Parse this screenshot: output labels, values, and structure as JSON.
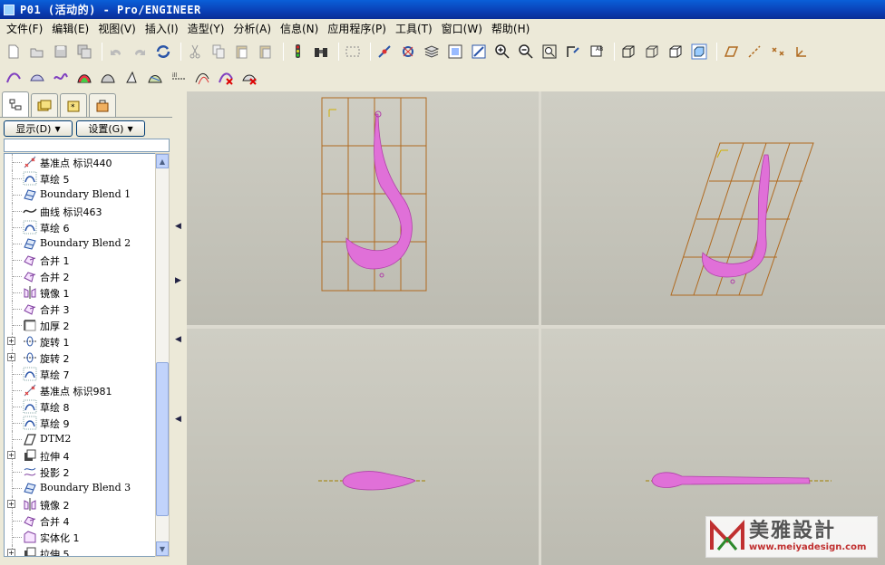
{
  "window": {
    "title": "P01 (活动的) - Pro/ENGINEER"
  },
  "menu": [
    "文件(F)",
    "编辑(E)",
    "视图(V)",
    "插入(I)",
    "造型(Y)",
    "分析(A)",
    "信息(N)",
    "应用程序(P)",
    "工具(T)",
    "窗口(W)",
    "帮助(H)"
  ],
  "toolbar1": [
    "new-file-icon",
    "open-file-icon",
    "save-icon",
    "save-copy-icon",
    "undo-icon",
    "redo-icon",
    "regenerate-icon",
    "cut-icon",
    "copy-icon",
    "paste-icon",
    "paste-special-icon",
    "traffic-light-icon",
    "find-binoculars-icon",
    "select-box-icon",
    "datum-point-icon",
    "spin-center-icon",
    "layers-icon",
    "view-manager-icon",
    "orient-icon",
    "zoom-in-icon",
    "zoom-out-icon",
    "refit-icon",
    "reorient-icon",
    "saved-views-icon",
    "wireframe-icon",
    "hidden-line-icon",
    "no-hidden-icon",
    "shading-icon",
    "datum-plane-toggle-icon",
    "datum-axis-toggle-icon",
    "datum-point-toggle-icon",
    "csys-toggle-icon"
  ],
  "toolbar2": [
    "curve-analysis-icon",
    "surface-analysis-icon",
    "curvature-icon",
    "shade-curvature-icon",
    "draft-analysis-icon",
    "slope-icon",
    "reflection-icon",
    "section-analysis-icon",
    "offset-analysis-icon",
    "delete-analysis-icon",
    "clear-analysis-icon"
  ],
  "panel": {
    "show_label": "显示(D)",
    "settings_label": "设置(G)"
  },
  "tree": [
    {
      "label": "基准点 标识440",
      "icon": "datum-point-icon",
      "expandable": false
    },
    {
      "label": "草绘 5",
      "icon": "sketch-icon",
      "expandable": false
    },
    {
      "label": "Boundary Blend 1",
      "icon": "boundary-blend-icon",
      "expandable": false
    },
    {
      "label": "曲线 标识463",
      "icon": "curve-icon",
      "expandable": false
    },
    {
      "label": "草绘 6",
      "icon": "sketch-icon",
      "expandable": false
    },
    {
      "label": "Boundary Blend 2",
      "icon": "boundary-blend-icon",
      "expandable": false
    },
    {
      "label": "合并 1",
      "icon": "merge-icon",
      "expandable": false
    },
    {
      "label": "合并 2",
      "icon": "merge-icon",
      "expandable": false
    },
    {
      "label": "镜像 1",
      "icon": "mirror-icon",
      "expandable": false
    },
    {
      "label": "合并 3",
      "icon": "merge-icon",
      "expandable": false
    },
    {
      "label": "加厚 2",
      "icon": "thicken-icon",
      "expandable": false
    },
    {
      "label": "旋转 1",
      "icon": "revolve-icon",
      "expandable": true
    },
    {
      "label": "旋转 2",
      "icon": "revolve-icon",
      "expandable": true
    },
    {
      "label": "草绘 7",
      "icon": "sketch-icon",
      "expandable": false
    },
    {
      "label": "基准点 标识981",
      "icon": "datum-point-icon",
      "expandable": false
    },
    {
      "label": "草绘 8",
      "icon": "sketch-icon",
      "expandable": false
    },
    {
      "label": "草绘 9",
      "icon": "sketch-icon",
      "expandable": false
    },
    {
      "label": "DTM2",
      "icon": "datum-plane-icon",
      "expandable": false
    },
    {
      "label": "拉伸 4",
      "icon": "extrude-icon",
      "expandable": true
    },
    {
      "label": "投影 2",
      "icon": "project-icon",
      "expandable": false
    },
    {
      "label": "Boundary Blend 3",
      "icon": "boundary-blend-icon",
      "expandable": false
    },
    {
      "label": "镜像 2",
      "icon": "mirror-icon",
      "expandable": true
    },
    {
      "label": "合并 4",
      "icon": "merge-icon",
      "expandable": false
    },
    {
      "label": "实体化 1",
      "icon": "solidify-icon",
      "expandable": false
    },
    {
      "label": "拉伸 5",
      "icon": "extrude-icon",
      "expandable": true
    }
  ],
  "watermark": {
    "cn": "美雅設計",
    "url": "www.meiyadesign.com"
  },
  "colors": {
    "model": "#e070d8",
    "grid": "#b06a20",
    "title": "#0a3fb5"
  }
}
